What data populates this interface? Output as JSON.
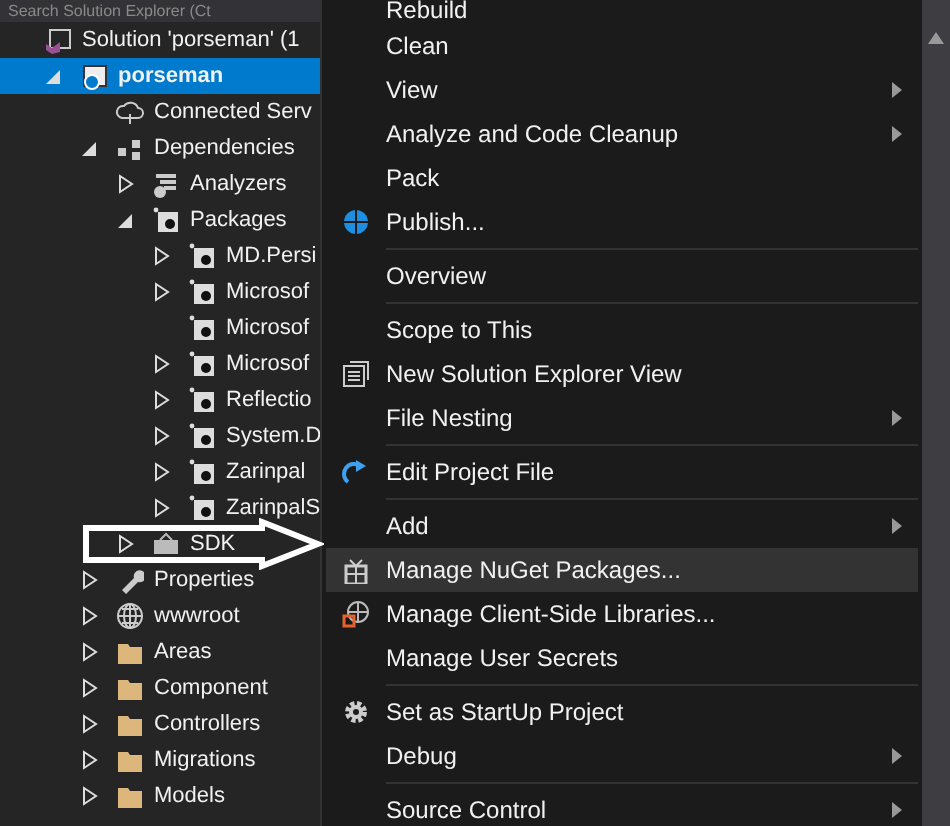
{
  "search": {
    "placeholder": "Search Solution Explorer (Ct"
  },
  "tree": [
    {
      "label": "Solution 'porseman' (1",
      "kind": "solution",
      "selected": false,
      "children": [
        {
          "label": "porseman",
          "kind": "web-project",
          "selected": true,
          "expanded": true,
          "children": [
            {
              "label": "Connected Serv",
              "kind": "connected",
              "selected": false
            },
            {
              "label": "Dependencies",
              "kind": "dependencies",
              "selected": false,
              "expanded": true,
              "children": [
                {
                  "label": "Analyzers",
                  "kind": "analyzers",
                  "selected": false,
                  "expanded": false
                },
                {
                  "label": "Packages",
                  "kind": "package",
                  "selected": false,
                  "expanded": true,
                  "children": [
                    {
                      "label": "MD.Persi",
                      "kind": "package",
                      "selected": false,
                      "expanded": false
                    },
                    {
                      "label": "Microsof",
                      "kind": "package",
                      "selected": false,
                      "expanded": false
                    },
                    {
                      "label": "Microsof",
                      "kind": "package",
                      "selected": false
                    },
                    {
                      "label": "Microsof",
                      "kind": "package",
                      "selected": false,
                      "expanded": false
                    },
                    {
                      "label": "Reflectio",
                      "kind": "package",
                      "selected": false,
                      "expanded": false
                    },
                    {
                      "label": "System.D",
                      "kind": "package",
                      "selected": false,
                      "expanded": false
                    },
                    {
                      "label": "Zarinpal",
                      "kind": "package",
                      "selected": false,
                      "expanded": false
                    },
                    {
                      "label": "ZarinpalS",
                      "kind": "package",
                      "selected": false,
                      "expanded": false
                    }
                  ]
                },
                {
                  "label": "SDK",
                  "kind": "sdk",
                  "selected": false,
                  "expanded": false
                }
              ]
            },
            {
              "label": "Properties",
              "kind": "properties",
              "selected": false,
              "expanded": false
            },
            {
              "label": "wwwroot",
              "kind": "globe",
              "selected": false,
              "expanded": false
            },
            {
              "label": "Areas",
              "kind": "folder",
              "selected": false,
              "expanded": false
            },
            {
              "label": "Component",
              "kind": "folder",
              "selected": false,
              "expanded": false
            },
            {
              "label": "Controllers",
              "kind": "folder",
              "selected": false,
              "expanded": false
            },
            {
              "label": "Migrations",
              "kind": "folder",
              "selected": false,
              "expanded": false
            },
            {
              "label": "Models",
              "kind": "folder",
              "selected": false,
              "expanded": false
            }
          ]
        }
      ]
    }
  ],
  "context_menu": [
    {
      "kind": "item",
      "label": "Rebuild",
      "selected": false,
      "submenu": false
    },
    {
      "kind": "item",
      "label": "Clean",
      "selected": false,
      "submenu": false
    },
    {
      "kind": "item",
      "label": "View",
      "selected": false,
      "submenu": true
    },
    {
      "kind": "item",
      "label": "Analyze and Code Cleanup",
      "selected": false,
      "submenu": true
    },
    {
      "kind": "item",
      "label": "Pack",
      "selected": false,
      "submenu": false
    },
    {
      "kind": "item",
      "label": "Publish...",
      "selected": false,
      "submenu": false
    },
    {
      "kind": "separator"
    },
    {
      "kind": "item",
      "label": "Overview",
      "selected": false,
      "submenu": false
    },
    {
      "kind": "separator"
    },
    {
      "kind": "item",
      "label": "Scope to This",
      "selected": false,
      "submenu": false
    },
    {
      "kind": "item",
      "label": "New Solution Explorer View",
      "selected": false,
      "submenu": false
    },
    {
      "kind": "item",
      "label": "File Nesting",
      "selected": false,
      "submenu": true
    },
    {
      "kind": "separator"
    },
    {
      "kind": "item",
      "label": "Edit Project File",
      "selected": false,
      "submenu": false
    },
    {
      "kind": "separator"
    },
    {
      "kind": "item",
      "label": "Add",
      "selected": false,
      "submenu": true
    },
    {
      "kind": "item",
      "label": "Manage NuGet Packages...",
      "selected": true,
      "submenu": false
    },
    {
      "kind": "item",
      "label": "Manage Client-Side Libraries...",
      "selected": false,
      "submenu": false
    },
    {
      "kind": "item",
      "label": "Manage User Secrets",
      "selected": false,
      "submenu": false
    },
    {
      "kind": "separator"
    },
    {
      "kind": "item",
      "label": "Set as StartUp Project",
      "selected": false,
      "submenu": false
    },
    {
      "kind": "item",
      "label": "Debug",
      "selected": false,
      "submenu": true
    },
    {
      "kind": "separator"
    },
    {
      "kind": "item",
      "label": "Source Control",
      "selected": false,
      "submenu": true
    }
  ]
}
